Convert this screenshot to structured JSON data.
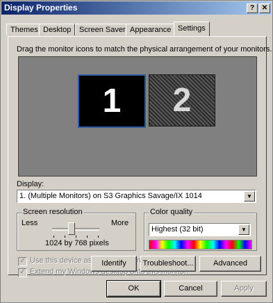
{
  "window": {
    "title": "Display Properties"
  },
  "titlebar": {
    "help": "?",
    "close": "✕"
  },
  "tabs": [
    "Themes",
    "Desktop",
    "Screen Saver",
    "Appearance",
    "Settings"
  ],
  "settings": {
    "instruction": "Drag the monitor icons to match the physical arrangement of your monitors.",
    "monitors": [
      "1",
      "2"
    ],
    "display_label": "Display:",
    "display_value": "1. (Multiple Monitors) on S3 Graphics Savage/IX 1014",
    "resolution": {
      "legend": "Screen resolution",
      "less": "Less",
      "more": "More",
      "value": "1024 by 768 pixels"
    },
    "color": {
      "legend": "Color quality",
      "value": "Highest (32 bit)"
    },
    "primary_checkbox": "Use this device as the primary monitor.",
    "extend_checkbox": "Extend my Windows desktop onto this monitor.",
    "buttons": {
      "identify": "Identify",
      "troubleshoot": "Troubleshoot...",
      "advanced": "Advanced"
    }
  },
  "footer": {
    "ok": "OK",
    "cancel": "Cancel",
    "apply": "Apply"
  },
  "icons": {
    "dropdown": "▼",
    "check": "✓"
  }
}
